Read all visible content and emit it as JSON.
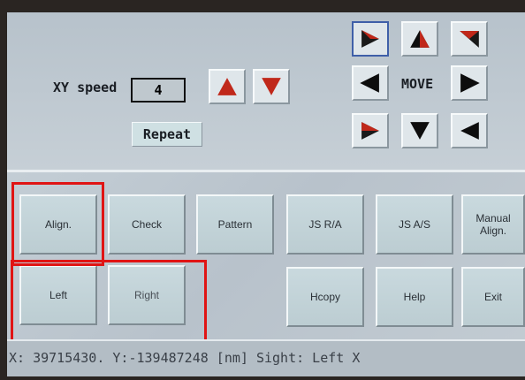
{
  "xy_speed": {
    "label": "XY speed",
    "value": "4"
  },
  "repeat_label": "Repeat",
  "move_label": "MOVE",
  "buttons": {
    "align": "Align.",
    "check": "Check",
    "pattern": "Pattern",
    "js_ra": "JS R/A",
    "js_as": "JS A/S",
    "manual_align": "Manual Align.",
    "left": "Left",
    "right": "Right",
    "hcopy": "Hcopy",
    "help": "Help",
    "exit": "Exit"
  },
  "status_bar": "X: 39715430. Y:-139487248 [nm] Sight: Left X",
  "colors": {
    "arrow_red": "#c0281a",
    "arrow_black": "#0d0d0d",
    "highlight": "#e01414"
  },
  "icons": [
    "arrow-up-icon",
    "arrow-down-icon",
    "arrow-left-icon",
    "arrow-right-icon",
    "arrow-diagonal-icon"
  ]
}
